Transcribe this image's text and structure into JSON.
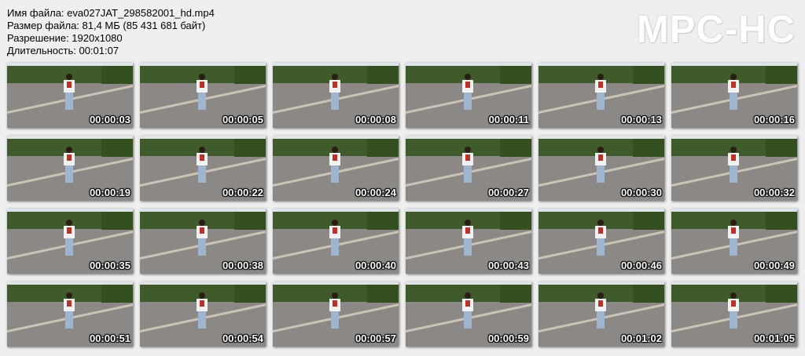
{
  "header": {
    "filename_line": "Имя файла: eva027JAT_298582001_hd.mp4",
    "filesize_line": "Размер файла: 81,4 МБ (85 431 681 байт)",
    "resolution_line": "Разрешение: 1920x1080",
    "duration_line": "Длительность: 00:01:07"
  },
  "logo": "MPC-HC",
  "thumbnails": [
    {
      "timestamp": "00:00:03"
    },
    {
      "timestamp": "00:00:05"
    },
    {
      "timestamp": "00:00:08"
    },
    {
      "timestamp": "00:00:11"
    },
    {
      "timestamp": "00:00:13"
    },
    {
      "timestamp": "00:00:16"
    },
    {
      "timestamp": "00:00:19"
    },
    {
      "timestamp": "00:00:22"
    },
    {
      "timestamp": "00:00:24"
    },
    {
      "timestamp": "00:00:27"
    },
    {
      "timestamp": "00:00:30"
    },
    {
      "timestamp": "00:00:32"
    },
    {
      "timestamp": "00:00:35"
    },
    {
      "timestamp": "00:00:38"
    },
    {
      "timestamp": "00:00:40"
    },
    {
      "timestamp": "00:00:43"
    },
    {
      "timestamp": "00:00:46"
    },
    {
      "timestamp": "00:00:49"
    },
    {
      "timestamp": "00:00:51"
    },
    {
      "timestamp": "00:00:54"
    },
    {
      "timestamp": "00:00:57"
    },
    {
      "timestamp": "00:00:59"
    },
    {
      "timestamp": "00:01:02"
    },
    {
      "timestamp": "00:01:05"
    }
  ]
}
